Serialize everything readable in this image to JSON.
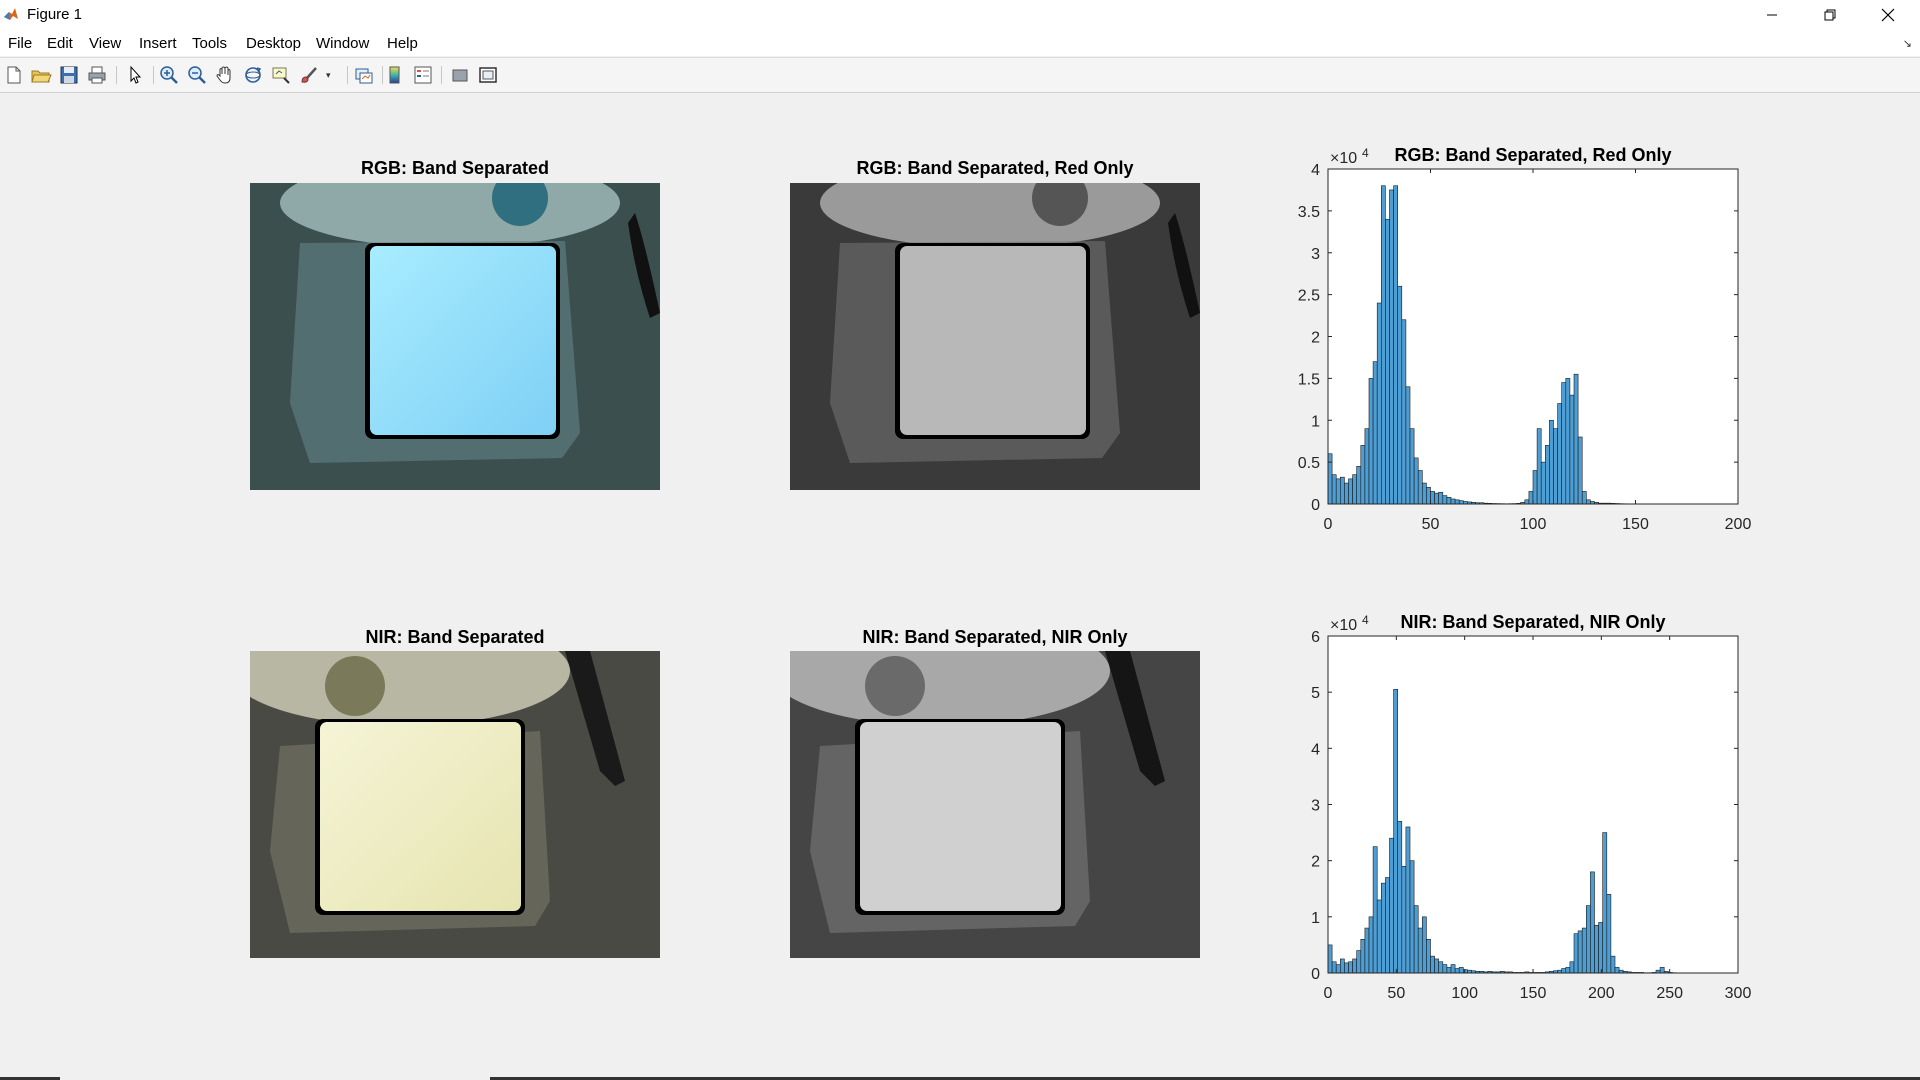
{
  "window": {
    "title": "Figure 1"
  },
  "menu": [
    "File",
    "Edit",
    "View",
    "Insert",
    "Tools",
    "Desktop",
    "Window",
    "Help"
  ],
  "toolbar_icons": [
    "new-figure-icon",
    "open-icon",
    "save-icon",
    "print-icon",
    "pointer-icon",
    "zoom-in-icon",
    "zoom-out-icon",
    "pan-icon",
    "rotate-3d-icon",
    "data-cursor-icon",
    "brush-icon",
    "link-plot-icon",
    "colorbar-icon",
    "legend-icon",
    "hide-plot-tools-icon",
    "show-plot-tools-icon"
  ],
  "images": {
    "rgb": {
      "title": "RGB: Band Separated"
    },
    "rgb_red": {
      "title": "RGB: Band Separated, Red Only"
    },
    "nir": {
      "title": "NIR: Band Separated"
    },
    "nir_only": {
      "title": "NIR: Band Separated, NIR Only"
    }
  },
  "chart_data": [
    {
      "type": "bar",
      "title": "RGB: Band Separated, Red Only",
      "xlabel": "",
      "ylabel": "",
      "xlim": [
        0,
        200
      ],
      "ylim": [
        0,
        40000
      ],
      "exponent_label": "×10",
      "exponent_power": "4",
      "xticks": [
        "0",
        "50",
        "100",
        "150",
        "200"
      ],
      "yticks": [
        "0",
        "0.5",
        "1",
        "1.5",
        "2",
        "2.5",
        "3",
        "3.5",
        "4"
      ],
      "bin_width": 2,
      "x": [
        1,
        3,
        5,
        7,
        9,
        11,
        13,
        15,
        17,
        19,
        21,
        23,
        25,
        27,
        29,
        31,
        33,
        35,
        37,
        39,
        41,
        43,
        45,
        47,
        49,
        51,
        53,
        55,
        57,
        59,
        61,
        63,
        65,
        67,
        69,
        71,
        73,
        75,
        77,
        79,
        81,
        83,
        85,
        87,
        89,
        91,
        93,
        95,
        97,
        99,
        101,
        103,
        105,
        107,
        109,
        111,
        113,
        115,
        117,
        119,
        121,
        123,
        125,
        127,
        129,
        131,
        133,
        135,
        137,
        139,
        141,
        143,
        145,
        147,
        149,
        151,
        153,
        155,
        157,
        159,
        161,
        163,
        165,
        167,
        169,
        171,
        173,
        175,
        177,
        179,
        181,
        183,
        185,
        187,
        189,
        191,
        193,
        195,
        197,
        199
      ],
      "values": [
        6000,
        3500,
        3000,
        3200,
        2500,
        3000,
        3500,
        4500,
        7000,
        9000,
        15000,
        17000,
        24000,
        38000,
        34000,
        37500,
        38000,
        26000,
        22000,
        14000,
        9000,
        5500,
        4000,
        2500,
        2000,
        1500,
        1300,
        1400,
        1000,
        800,
        600,
        500,
        400,
        300,
        250,
        200,
        150,
        150,
        100,
        80,
        60,
        50,
        40,
        30,
        40,
        50,
        80,
        200,
        500,
        1500,
        4000,
        9000,
        5000,
        7000,
        10000,
        9000,
        12000,
        14500,
        15000,
        13000,
        15500,
        8000,
        1500,
        500,
        300,
        200,
        100,
        100,
        100,
        80,
        60,
        40,
        30,
        20,
        10,
        10,
        0,
        0,
        0,
        0,
        0,
        0,
        0,
        0,
        0,
        0,
        0,
        0,
        0,
        0,
        0,
        0,
        0,
        0,
        0,
        0,
        0,
        0,
        0,
        0
      ],
      "color": "#4d9ed4"
    },
    {
      "type": "bar",
      "title": "NIR: Band Separated, NIR Only",
      "xlabel": "",
      "ylabel": "",
      "xlim": [
        0,
        300
      ],
      "ylim": [
        0,
        60000
      ],
      "exponent_label": "×10",
      "exponent_power": "4",
      "xticks": [
        "0",
        "50",
        "100",
        "150",
        "200",
        "250",
        "300"
      ],
      "yticks": [
        "0",
        "1",
        "2",
        "3",
        "4",
        "5",
        "6"
      ],
      "bin_width": 3,
      "x": [
        1.5,
        4.5,
        7.5,
        10.5,
        13.5,
        16.5,
        19.5,
        22.5,
        25.5,
        28.5,
        31.5,
        34.5,
        37.5,
        40.5,
        43.5,
        46.5,
        49.5,
        52.5,
        55.5,
        58.5,
        61.5,
        64.5,
        67.5,
        70.5,
        73.5,
        76.5,
        79.5,
        82.5,
        85.5,
        88.5,
        91.5,
        94.5,
        97.5,
        100.5,
        103.5,
        106.5,
        109.5,
        112.5,
        115.5,
        118.5,
        121.5,
        124.5,
        127.5,
        130.5,
        133.5,
        136.5,
        139.5,
        142.5,
        145.5,
        148.5,
        151.5,
        154.5,
        157.5,
        160.5,
        163.5,
        166.5,
        169.5,
        172.5,
        175.5,
        178.5,
        181.5,
        184.5,
        187.5,
        190.5,
        193.5,
        196.5,
        199.5,
        202.5,
        205.5,
        208.5,
        211.5,
        214.5,
        217.5,
        220.5,
        223.5,
        226.5,
        229.5,
        232.5,
        235.5,
        238.5,
        241.5,
        244.5,
        247.5,
        250.5,
        253.5,
        256.5,
        259.5,
        262.5,
        265.5,
        268.5,
        271.5,
        274.5,
        277.5,
        280.5,
        283.5,
        286.5,
        289.5,
        292.5,
        295.5,
        298.5
      ],
      "values": [
        5000,
        2000,
        1500,
        2500,
        1800,
        2000,
        2500,
        4000,
        6000,
        8000,
        10000,
        22500,
        13000,
        16000,
        17000,
        24000,
        50500,
        27000,
        19000,
        26000,
        20000,
        12000,
        8000,
        10000,
        6000,
        3000,
        2500,
        2000,
        1500,
        1000,
        1500,
        800,
        1000,
        600,
        500,
        400,
        300,
        300,
        200,
        300,
        200,
        200,
        300,
        200,
        200,
        100,
        100,
        100,
        200,
        100,
        100,
        100,
        100,
        200,
        300,
        400,
        500,
        800,
        1000,
        2000,
        7000,
        7500,
        8000,
        12000,
        18000,
        8500,
        9000,
        25000,
        14000,
        3000,
        1000,
        500,
        300,
        200,
        100,
        100,
        100,
        50,
        50,
        100,
        500,
        1000,
        300,
        100,
        50,
        30,
        20,
        10,
        0,
        0,
        0,
        0,
        0,
        0,
        0,
        0,
        0,
        0,
        0,
        0
      ],
      "color": "#4d9ed4"
    }
  ]
}
